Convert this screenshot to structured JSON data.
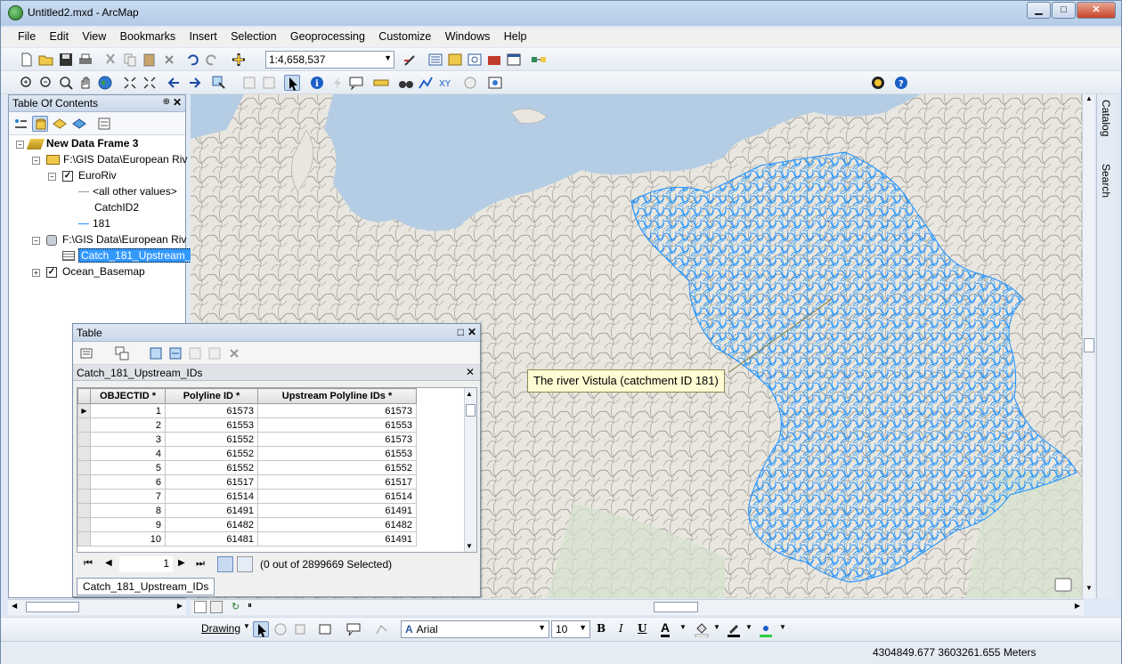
{
  "window": {
    "title": "Untitled2.mxd - ArcMap",
    "controls": {
      "minimize": "▁",
      "maximize": "□",
      "close": "✕"
    }
  },
  "menu": [
    "File",
    "Edit",
    "View",
    "Bookmarks",
    "Insert",
    "Selection",
    "Geoprocessing",
    "Customize",
    "Windows",
    "Help"
  ],
  "standard_toolbar": {
    "scale_value": "1:4,658,537"
  },
  "toc": {
    "title": "Table Of Contents",
    "pin": "⊕",
    "close": "✕",
    "data_frame": "New Data Frame 3",
    "folder1": "F:\\GIS Data\\European Riv",
    "layer_euroriv": "EuroRiv",
    "legend_other": "<all other values>",
    "legend_field": "CatchID2",
    "legend_value": "181",
    "folder2": "F:\\GIS Data\\European Riv",
    "table_selected": "Catch_181_Upstream_",
    "basemap": "Ocean_Basemap"
  },
  "map": {
    "callout_text": "The river Vistula (catchment ID 181)",
    "accent_river": "#1e90ff",
    "sea_color": "#b5cde4",
    "land_color": "#e8e6de"
  },
  "right_sidebar": {
    "catalog": "Catalog",
    "search": "Search"
  },
  "table_window": {
    "title": "Table",
    "table_name": "Catch_181_Upstream_IDs",
    "columns": [
      "OBJECTID *",
      "Polyline ID *",
      "Upstream Polyline IDs *"
    ],
    "rows": [
      [
        "1",
        "61573",
        "61573"
      ],
      [
        "2",
        "61553",
        "61553"
      ],
      [
        "3",
        "61552",
        "61573"
      ],
      [
        "4",
        "61552",
        "61553"
      ],
      [
        "5",
        "61552",
        "61552"
      ],
      [
        "6",
        "61517",
        "61517"
      ],
      [
        "7",
        "61514",
        "61514"
      ],
      [
        "8",
        "61491",
        "61491"
      ],
      [
        "9",
        "61482",
        "61482"
      ],
      [
        "10",
        "61481",
        "61491"
      ]
    ],
    "record_number": "1",
    "selection_status": "(0 out of 2899669 Selected)",
    "tab_label": "Catch_181_Upstream_IDs"
  },
  "drawing_toolbar": {
    "drawing_label": "Drawing",
    "font_name": "Arial",
    "font_size": "10",
    "bold": "B",
    "italic": "I",
    "underline": "U",
    "font_color_glyph": "A"
  },
  "status": {
    "coordinates": "4304849.677  3603261.655 Meters"
  }
}
